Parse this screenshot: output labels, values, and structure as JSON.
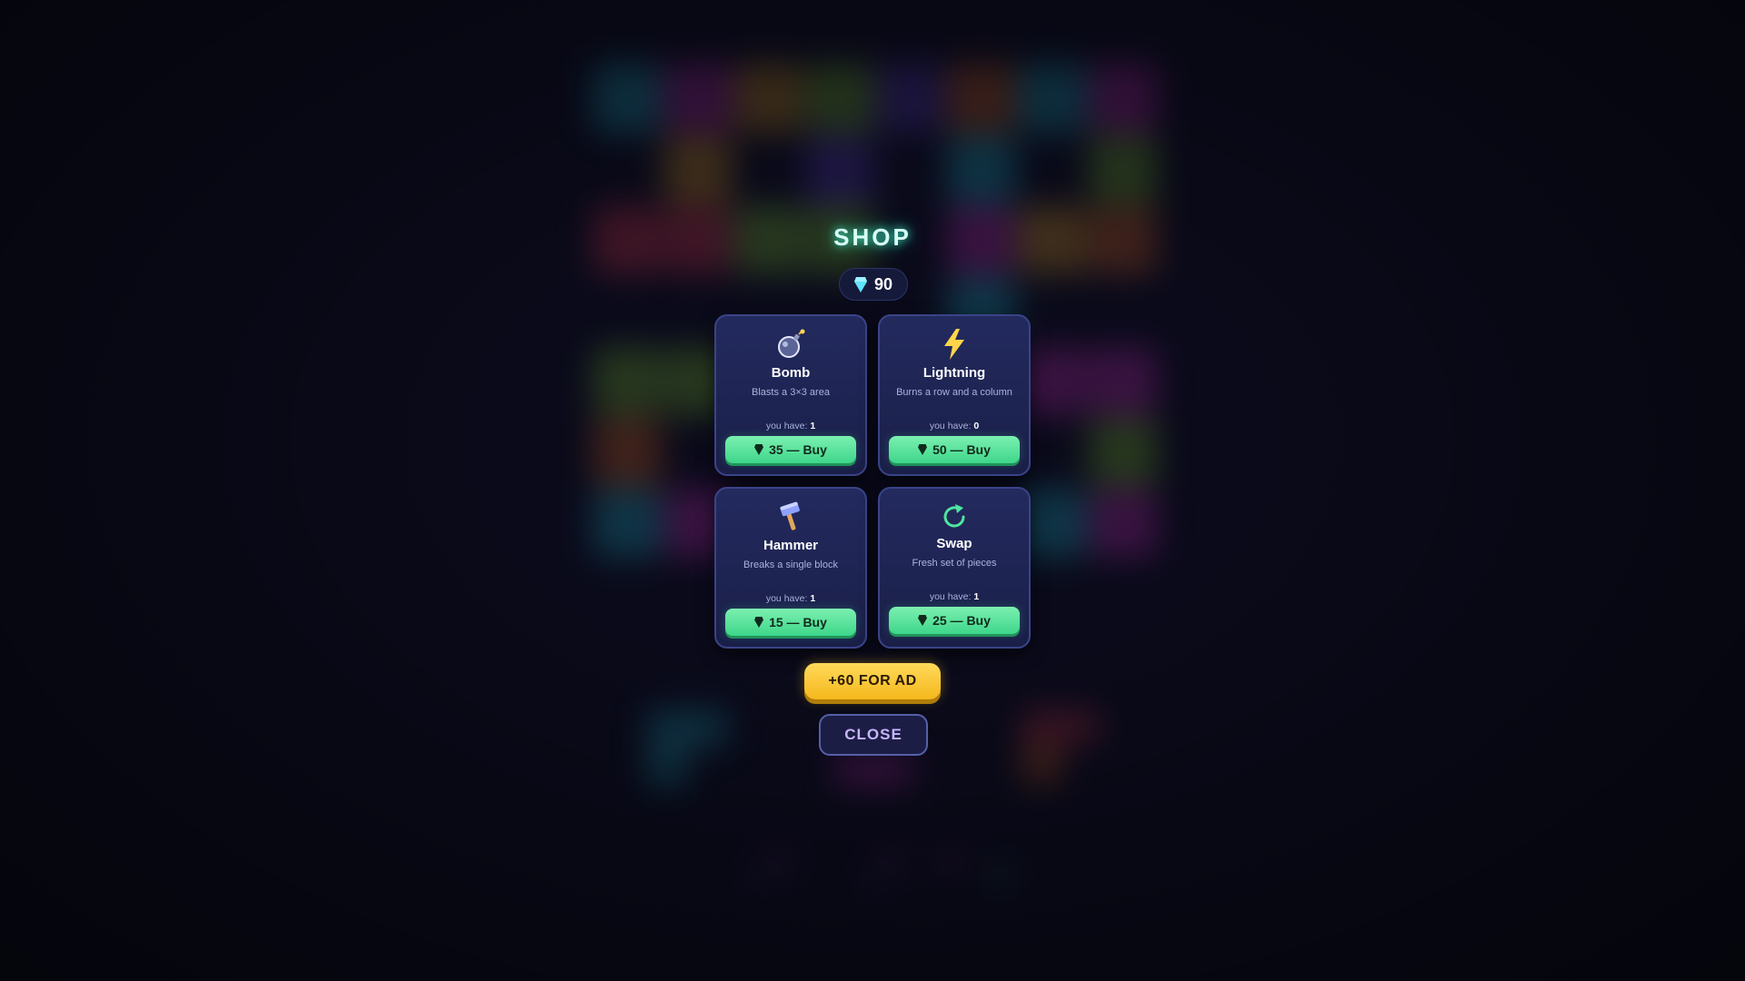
{
  "shop": {
    "title": "SHOP",
    "gems": "90",
    "items": [
      {
        "name": "Bomb",
        "description": "Blasts a 3×3 area",
        "have_label": "you have:",
        "have_count": "1",
        "price": "35 — Buy"
      },
      {
        "name": "Lightning",
        "description": "Burns a row and a column",
        "have_label": "you have:",
        "have_count": "0",
        "price": "50 — Buy"
      },
      {
        "name": "Hammer",
        "description": "Breaks a single block",
        "have_label": "you have:",
        "have_count": "1",
        "price": "15 — Buy"
      },
      {
        "name": "Swap",
        "description": "Fresh set of pieces",
        "have_label": "you have:",
        "have_count": "1",
        "price": "25 — Buy"
      }
    ],
    "ad_button": "+60 FOR AD",
    "close_button": "CLOSE"
  },
  "icons": {
    "gem": "gem-icon",
    "bomb": "bomb-icon",
    "lightning": "lightning-icon",
    "hammer": "hammer-icon",
    "swap": "refresh-icon"
  },
  "colors": {
    "accent_teal": "#3cf0c8",
    "buy_green": "#3ed68a",
    "ad_gold": "#f5b81c",
    "close_border": "#5560a8",
    "card_bg": "#232a5e",
    "gem_cyan": "#5fe3ff"
  }
}
